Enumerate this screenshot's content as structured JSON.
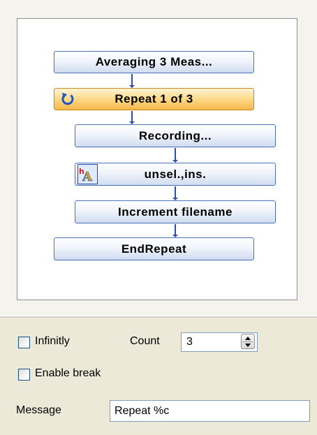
{
  "flow": {
    "nodes": [
      {
        "label": "Averaging 3 Meas..."
      },
      {
        "label": "Repeat 1 of 3",
        "icon": "repeat-icon",
        "active": true
      },
      {
        "label": "Recording..."
      },
      {
        "label": "unsel.,ins.",
        "icon": "insert-icon"
      },
      {
        "label": "Increment filename"
      },
      {
        "label": "EndRepeat"
      }
    ]
  },
  "form": {
    "infinity_label": "Infinitly",
    "infinity_checked": false,
    "count_label": "Count",
    "count_value": "3",
    "enable_break_label": "Enable break",
    "enable_break_checked": false,
    "message_label": "Message",
    "message_value": "Repeat %c"
  },
  "colors": {
    "node_border": "#4a72b8",
    "active_node": "#f7b84a",
    "connector": "#2a4fa8"
  }
}
